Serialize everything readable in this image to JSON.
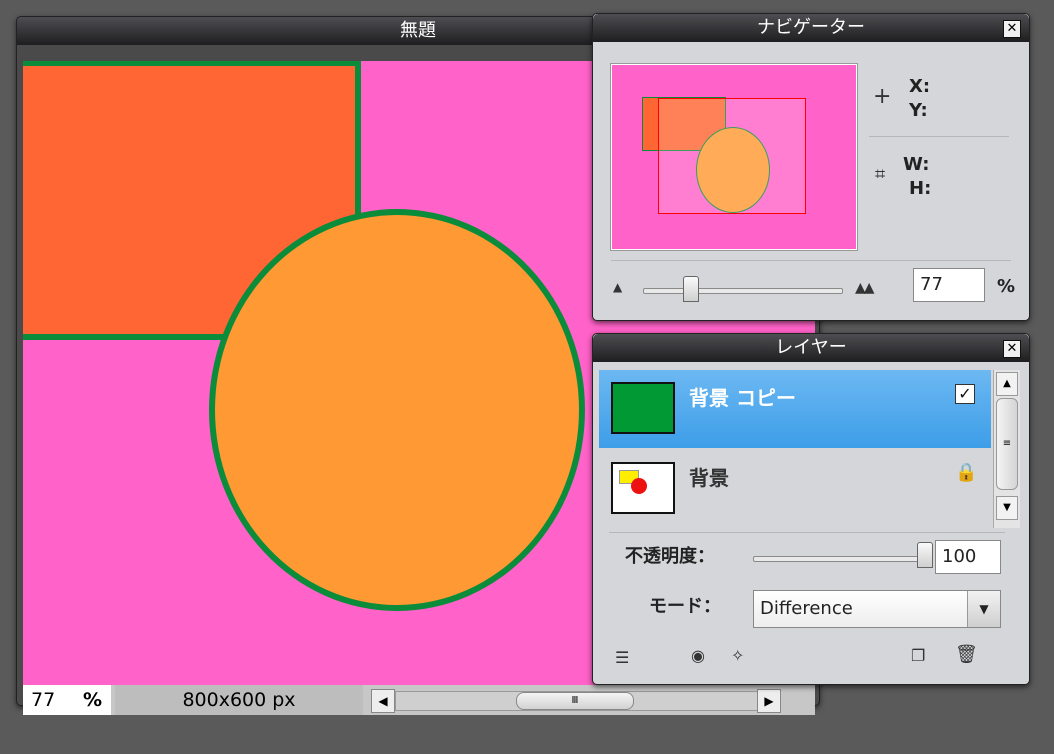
{
  "canvas_window": {
    "title": "無題",
    "zoom_value": "77",
    "zoom_unit": "%",
    "dimensions": "800x600 px",
    "colors": {
      "background": "#ff62c8",
      "rectangle": "#ff6633",
      "ellipse": "#ff9933",
      "stroke": "#0a8c3a"
    }
  },
  "navigator": {
    "title": "ナビゲーター",
    "x_label": "X:",
    "y_label": "Y:",
    "w_label": "W:",
    "h_label": "H:",
    "zoom_value": "77",
    "zoom_unit": "%",
    "zoom_level_percent": 77
  },
  "layers": {
    "title": "レイヤー",
    "items": [
      {
        "name": "背景 コピー",
        "selected": true,
        "visible_checked": true,
        "thumb_color": "#009933"
      },
      {
        "name": "背景",
        "selected": false,
        "locked": true
      }
    ],
    "opacity_label": "不透明度：",
    "opacity_value": "100",
    "mode_label": "モード：",
    "mode_value": "Difference",
    "colors": {
      "selected_row": "#3d9ee8",
      "selected_text": "#ffffff"
    }
  }
}
